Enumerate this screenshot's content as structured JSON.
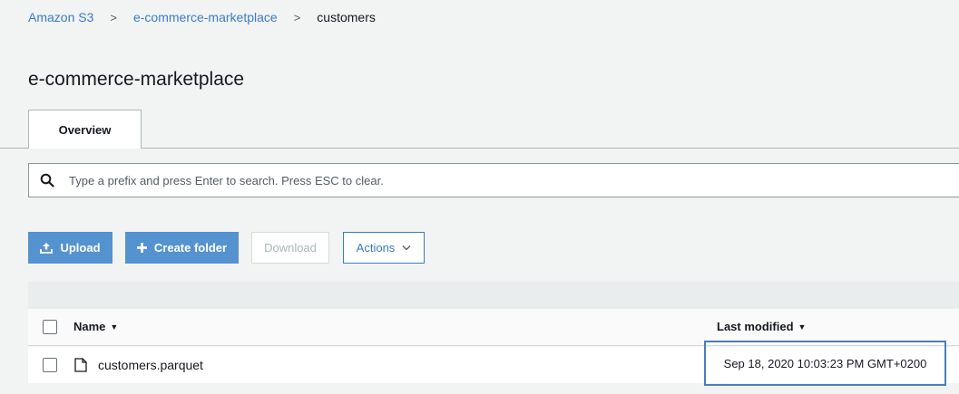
{
  "breadcrumb": {
    "items": [
      {
        "label": "Amazon S3"
      },
      {
        "label": "e-commerce-marketplace"
      }
    ],
    "current": "customers",
    "separator": ">"
  },
  "page": {
    "title": "e-commerce-marketplace"
  },
  "tabs": [
    {
      "label": "Overview",
      "active": true
    }
  ],
  "search": {
    "placeholder": "Type a prefix and press Enter to search. Press ESC to clear.",
    "value": "",
    "icon": "search-icon"
  },
  "toolbar": {
    "upload_label": "Upload",
    "create_folder_label": "Create folder",
    "download_label": "Download",
    "actions_label": "Actions"
  },
  "table": {
    "columns": [
      {
        "label": "Name",
        "sort": "desc"
      },
      {
        "label": "Last modified",
        "sort": "desc"
      }
    ],
    "rows": [
      {
        "name": "customers.parquet",
        "last_modified": "Sep 18, 2020 10:03:23 PM GMT+0200",
        "icon": "file-icon"
      }
    ]
  },
  "colors": {
    "accent": "#3a7bc8",
    "primary_button": "#5592d0",
    "highlight_border": "#4a7ebb"
  }
}
